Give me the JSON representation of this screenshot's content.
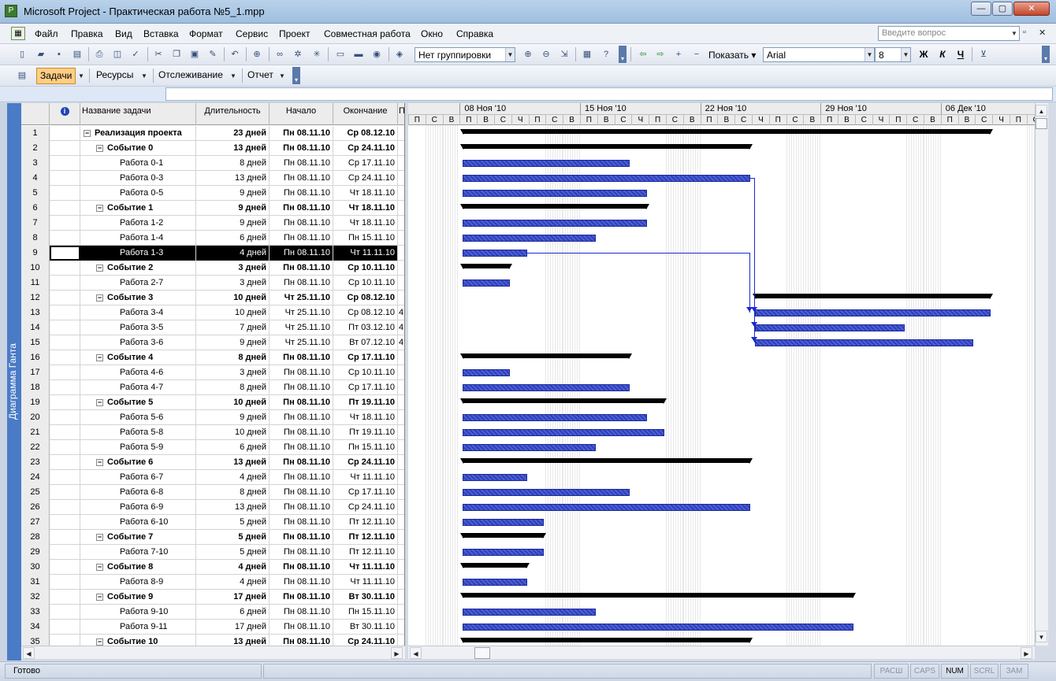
{
  "window": {
    "title": "Microsoft Project - Практическая работа №5_1.mpp"
  },
  "menu": {
    "items": [
      "Файл",
      "Правка",
      "Вид",
      "Вставка",
      "Формат",
      "Сервис",
      "Проект",
      "Совместная работа",
      "Окно",
      "Справка"
    ],
    "ask_placeholder": "Введите вопрос"
  },
  "toolbar": {
    "grouping": "Нет группировки",
    "show_label": "Показать",
    "font": "Arial",
    "font_size": "8",
    "bold": "Ж",
    "italic": "К",
    "underline": "Ч"
  },
  "viewtabs": {
    "tasks": "Задачи",
    "resources": "Ресурсы",
    "tracking": "Отслеживание",
    "report": "Отчет"
  },
  "view_label": "Диаграмма Ганта",
  "columns": {
    "indicator": "i",
    "name": "Название задачи",
    "duration": "Длительность",
    "start": "Начало",
    "finish": "Окончание",
    "pred": "П"
  },
  "tasks": [
    {
      "id": "1",
      "name": "Реализация проекта",
      "dur": "23 дней",
      "start": "Пн 08.11.10",
      "end": "Ср 08.12.10",
      "level": 0,
      "summary": true,
      "pred": ""
    },
    {
      "id": "2",
      "name": "Событие 0",
      "dur": "13 дней",
      "start": "Пн 08.11.10",
      "end": "Ср 24.11.10",
      "level": 1,
      "summary": true,
      "pred": ""
    },
    {
      "id": "3",
      "name": "Работа 0-1",
      "dur": "8 дней",
      "start": "Пн 08.11.10",
      "end": "Ср 17.11.10",
      "level": 2,
      "summary": false,
      "pred": ""
    },
    {
      "id": "4",
      "name": "Работа 0-3",
      "dur": "13 дней",
      "start": "Пн 08.11.10",
      "end": "Ср 24.11.10",
      "level": 2,
      "summary": false,
      "pred": ""
    },
    {
      "id": "5",
      "name": "Работа 0-5",
      "dur": "9 дней",
      "start": "Пн 08.11.10",
      "end": "Чт 18.11.10",
      "level": 2,
      "summary": false,
      "pred": ""
    },
    {
      "id": "6",
      "name": "Событие 1",
      "dur": "9 дней",
      "start": "Пн 08.11.10",
      "end": "Чт 18.11.10",
      "level": 1,
      "summary": true,
      "pred": ""
    },
    {
      "id": "7",
      "name": "Работа 1-2",
      "dur": "9 дней",
      "start": "Пн 08.11.10",
      "end": "Чт 18.11.10",
      "level": 2,
      "summary": false,
      "pred": ""
    },
    {
      "id": "8",
      "name": "Работа 1-4",
      "dur": "6 дней",
      "start": "Пн 08.11.10",
      "end": "Пн 15.11.10",
      "level": 2,
      "summary": false,
      "pred": ""
    },
    {
      "id": "9",
      "name": "Работа 1-3",
      "dur": "4 дней",
      "start": "Пн 08.11.10",
      "end": "Чт 11.11.10",
      "level": 2,
      "summary": false,
      "pred": "",
      "selected": true
    },
    {
      "id": "10",
      "name": "Событие 2",
      "dur": "3 дней",
      "start": "Пн 08.11.10",
      "end": "Ср 10.11.10",
      "level": 1,
      "summary": true,
      "pred": ""
    },
    {
      "id": "11",
      "name": "Работа 2-7",
      "dur": "3 дней",
      "start": "Пн 08.11.10",
      "end": "Ср 10.11.10",
      "level": 2,
      "summary": false,
      "pred": ""
    },
    {
      "id": "12",
      "name": "Событие 3",
      "dur": "10 дней",
      "start": "Чт 25.11.10",
      "end": "Ср 08.12.10",
      "level": 1,
      "summary": true,
      "pred": ""
    },
    {
      "id": "13",
      "name": "Работа 3-4",
      "dur": "10 дней",
      "start": "Чт 25.11.10",
      "end": "Ср 08.12.10",
      "level": 2,
      "summary": false,
      "pred": "4"
    },
    {
      "id": "14",
      "name": "Работа 3-5",
      "dur": "7 дней",
      "start": "Чт 25.11.10",
      "end": "Пт 03.12.10",
      "level": 2,
      "summary": false,
      "pred": "4"
    },
    {
      "id": "15",
      "name": "Работа 3-6",
      "dur": "9 дней",
      "start": "Чт 25.11.10",
      "end": "Вт 07.12.10",
      "level": 2,
      "summary": false,
      "pred": "4"
    },
    {
      "id": "16",
      "name": "Событие 4",
      "dur": "8 дней",
      "start": "Пн 08.11.10",
      "end": "Ср 17.11.10",
      "level": 1,
      "summary": true,
      "pred": ""
    },
    {
      "id": "17",
      "name": "Работа 4-6",
      "dur": "3 дней",
      "start": "Пн 08.11.10",
      "end": "Ср 10.11.10",
      "level": 2,
      "summary": false,
      "pred": ""
    },
    {
      "id": "18",
      "name": "Работа 4-7",
      "dur": "8 дней",
      "start": "Пн 08.11.10",
      "end": "Ср 17.11.10",
      "level": 2,
      "summary": false,
      "pred": ""
    },
    {
      "id": "19",
      "name": "Событие 5",
      "dur": "10 дней",
      "start": "Пн 08.11.10",
      "end": "Пт 19.11.10",
      "level": 1,
      "summary": true,
      "pred": ""
    },
    {
      "id": "20",
      "name": "Работа 5-6",
      "dur": "9 дней",
      "start": "Пн 08.11.10",
      "end": "Чт 18.11.10",
      "level": 2,
      "summary": false,
      "pred": ""
    },
    {
      "id": "21",
      "name": "Работа 5-8",
      "dur": "10 дней",
      "start": "Пн 08.11.10",
      "end": "Пт 19.11.10",
      "level": 2,
      "summary": false,
      "pred": ""
    },
    {
      "id": "22",
      "name": "Работа 5-9",
      "dur": "6 дней",
      "start": "Пн 08.11.10",
      "end": "Пн 15.11.10",
      "level": 2,
      "summary": false,
      "pred": ""
    },
    {
      "id": "23",
      "name": "Событие 6",
      "dur": "13 дней",
      "start": "Пн 08.11.10",
      "end": "Ср 24.11.10",
      "level": 1,
      "summary": true,
      "pred": ""
    },
    {
      "id": "24",
      "name": "Работа 6-7",
      "dur": "4 дней",
      "start": "Пн 08.11.10",
      "end": "Чт 11.11.10",
      "level": 2,
      "summary": false,
      "pred": ""
    },
    {
      "id": "25",
      "name": "Работа 6-8",
      "dur": "8 дней",
      "start": "Пн 08.11.10",
      "end": "Ср 17.11.10",
      "level": 2,
      "summary": false,
      "pred": ""
    },
    {
      "id": "26",
      "name": "Работа 6-9",
      "dur": "13 дней",
      "start": "Пн 08.11.10",
      "end": "Ср 24.11.10",
      "level": 2,
      "summary": false,
      "pred": ""
    },
    {
      "id": "27",
      "name": "Работа 6-10",
      "dur": "5 дней",
      "start": "Пн 08.11.10",
      "end": "Пт 12.11.10",
      "level": 2,
      "summary": false,
      "pred": ""
    },
    {
      "id": "28",
      "name": "Событие 7",
      "dur": "5 дней",
      "start": "Пн 08.11.10",
      "end": "Пт 12.11.10",
      "level": 1,
      "summary": true,
      "pred": ""
    },
    {
      "id": "29",
      "name": "Работа 7-10",
      "dur": "5 дней",
      "start": "Пн 08.11.10",
      "end": "Пт 12.11.10",
      "level": 2,
      "summary": false,
      "pred": ""
    },
    {
      "id": "30",
      "name": "Событие 8",
      "dur": "4 дней",
      "start": "Пн 08.11.10",
      "end": "Чт 11.11.10",
      "level": 1,
      "summary": true,
      "pred": ""
    },
    {
      "id": "31",
      "name": "Работа 8-9",
      "dur": "4 дней",
      "start": "Пн 08.11.10",
      "end": "Чт 11.11.10",
      "level": 2,
      "summary": false,
      "pred": ""
    },
    {
      "id": "32",
      "name": "Событие 9",
      "dur": "17 дней",
      "start": "Пн 08.11.10",
      "end": "Вт 30.11.10",
      "level": 1,
      "summary": true,
      "pred": ""
    },
    {
      "id": "33",
      "name": "Работа 9-10",
      "dur": "6 дней",
      "start": "Пн 08.11.10",
      "end": "Пн 15.11.10",
      "level": 2,
      "summary": false,
      "pred": ""
    },
    {
      "id": "34",
      "name": "Работа 9-11",
      "dur": "17 дней",
      "start": "Пн 08.11.10",
      "end": "Вт 30.11.10",
      "level": 2,
      "summary": false,
      "pred": ""
    },
    {
      "id": "35",
      "name": "Событие 10",
      "dur": "13 дней",
      "start": "Пн 08.11.10",
      "end": "Ср 24.11.10",
      "level": 1,
      "summary": true,
      "pred": ""
    }
  ],
  "timescale": {
    "weeks": [
      "08 Ноя '10",
      "15 Ноя '10",
      "22 Ноя '10",
      "29 Ноя '10",
      "06 Дек '10"
    ],
    "day_letters": [
      "П",
      "С",
      "В",
      "П",
      "В",
      "С",
      "Ч",
      "П",
      "С",
      "В",
      "П",
      "В",
      "С",
      "Ч",
      "П",
      "С",
      "В",
      "П",
      "В",
      "С",
      "Ч",
      "П",
      "С",
      "В",
      "П",
      "В",
      "С",
      "Ч",
      "П",
      "С",
      "В",
      "П",
      "В",
      "С",
      "Ч",
      "П",
      "С"
    ]
  },
  "status": {
    "ready": "Готово",
    "indicators": [
      {
        "label": "РАСШ",
        "on": false
      },
      {
        "label": "CAPS",
        "on": false
      },
      {
        "label": "NUM",
        "on": true
      },
      {
        "label": "SCRL",
        "on": false
      },
      {
        "label": "ЗАМ",
        "on": false
      }
    ]
  },
  "colors": {
    "task_bar": "#3a4fd0",
    "summary_bar": "#000000",
    "link": "#1a2ad0",
    "selected_row": "#000000",
    "view_bar": "#4a7bc7"
  }
}
